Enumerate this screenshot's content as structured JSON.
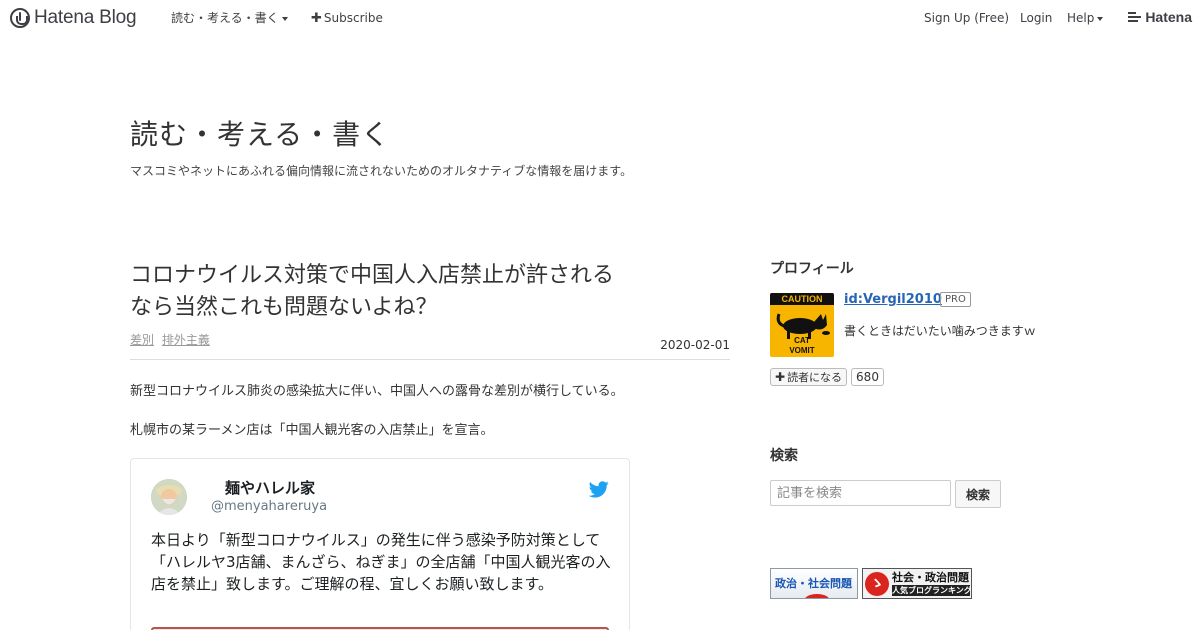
{
  "topbar": {
    "brand": "Hatena Blog",
    "blog_menu": "読む・考える・書く",
    "subscribe": "Subscribe",
    "signup": "Sign Up (Free)",
    "login": "Login",
    "help": "Help",
    "hatena": "Hatena"
  },
  "blog": {
    "title": "読む・考える・書く",
    "description": "マスコミやネットにあふれる偏向情報に流されないためのオルタナティブな情報を届けます。"
  },
  "entry": {
    "title": "コロナウイルス対策で中国人入店禁止が許されるなら当然これも問題ないよね？",
    "categories": [
      "差別",
      "排外主義"
    ],
    "date": "2020-02-01",
    "paragraphs": [
      "新型コロナウイルス肺炎の感染拡大に伴い、中国人への露骨な差別が横行している。",
      "札幌市の某ラーメン店は「中国人観光客の入店禁止」を宣言。"
    ]
  },
  "tweet": {
    "name": "麺やハレル家",
    "handle": "@menyahareruya",
    "text": "本日より「新型コロナウイルス」の発生に伴う感染予防対策として「ハレルヤ3店舗、まんざら、ねぎま」の全店舗「中国人観光客の入店を禁止」致します。ご理解の程、宜しくお願い致します。",
    "bird_color": "#1da1f2"
  },
  "sidebar": {
    "profile_heading": "プロフィール",
    "profile_id": "id:Vergil2010",
    "pro_badge": "PRO",
    "profile_desc": "書くときはだいたい噛みつきますｗ",
    "icon_caution": "CAUTION",
    "icon_cat": "CAT",
    "icon_vomit": "VOMIT",
    "subscribe_label": "読者になる",
    "subscriber_count": "680",
    "search_heading": "検索",
    "search_placeholder": "記事を検索",
    "search_button": "検索",
    "banner1": "政治・社会問題",
    "banner2_line1": "社会・政治問題",
    "banner2_line2": "人気ブログランキング"
  }
}
